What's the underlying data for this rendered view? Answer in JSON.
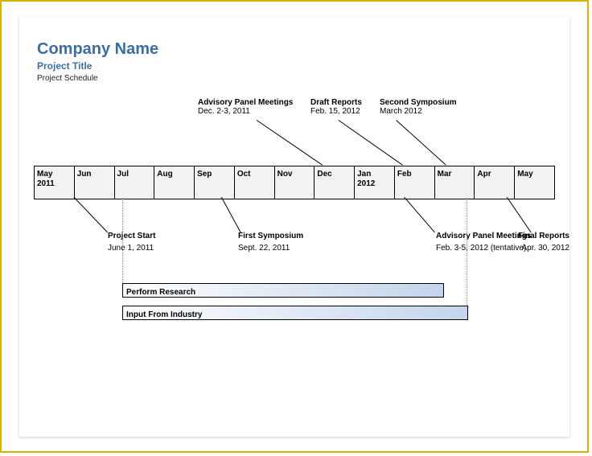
{
  "header": {
    "company": "Company Name",
    "project": "Project Title",
    "subtitle": "Project Schedule"
  },
  "months": [
    "May\n2011",
    "Jun",
    "Jul",
    "Aug",
    "Sep",
    "Oct",
    "Nov",
    "Dec",
    "Jan\n2012",
    "Feb",
    "Mar",
    "Apr",
    "May"
  ],
  "top_events": [
    {
      "title": "Advisory Panel Meetings",
      "date": "Dec. 2-3, 2011"
    },
    {
      "title": "Draft Reports",
      "date": "Feb. 15, 2012"
    },
    {
      "title": "Second Symposium",
      "date": "March 2012"
    }
  ],
  "bottom_events": [
    {
      "title": "Project Start",
      "date": "June 1, 2011"
    },
    {
      "title": "First Symposium",
      "date": "Sept. 22, 2011"
    },
    {
      "title": "Advisory Panel Meetings",
      "date": "Feb. 3-5, 2012 (tentative)"
    },
    {
      "title": "Final Reports",
      "date": "Apr. 30, 2012"
    }
  ],
  "bars": [
    {
      "label": "Perform Research"
    },
    {
      "label": "Input From Industry"
    }
  ]
}
